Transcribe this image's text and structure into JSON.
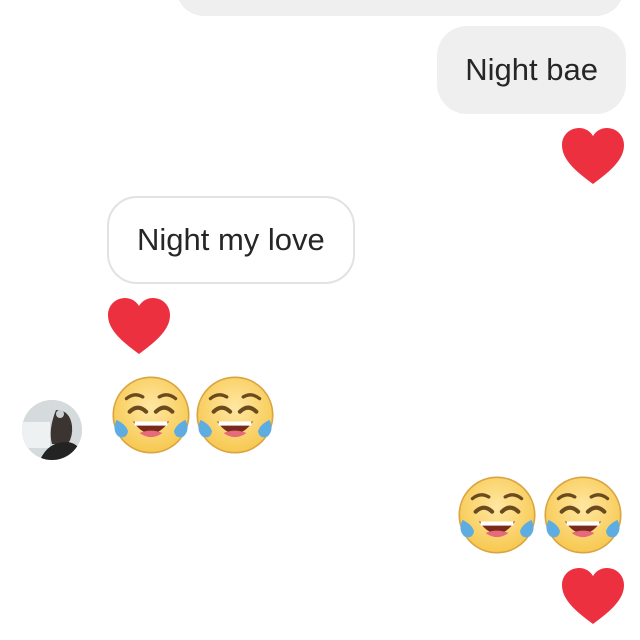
{
  "conversation": {
    "messages": [
      {
        "sender": "me",
        "text": "Night bae",
        "reaction": "heart"
      },
      {
        "sender": "them",
        "text": "Night my love",
        "reaction": "heart"
      }
    ],
    "emoji_messages": [
      {
        "sender": "them",
        "emoji": "face-with-tears-of-joy",
        "count": 2
      },
      {
        "sender": "me",
        "emoji": "face-with-tears-of-joy",
        "count": 2,
        "reaction": "heart"
      }
    ]
  },
  "colors": {
    "sent_bubble": "#efefef",
    "received_bubble_border": "#e2e2e2",
    "text": "#262626",
    "heart": "#ed3040",
    "emoji_face": "#fdd77a",
    "emoji_tears": "#5dade2"
  },
  "icons": {
    "reaction": "heart-icon",
    "emoji": "tears-of-joy-emoji-icon",
    "avatar": "contact-avatar"
  }
}
